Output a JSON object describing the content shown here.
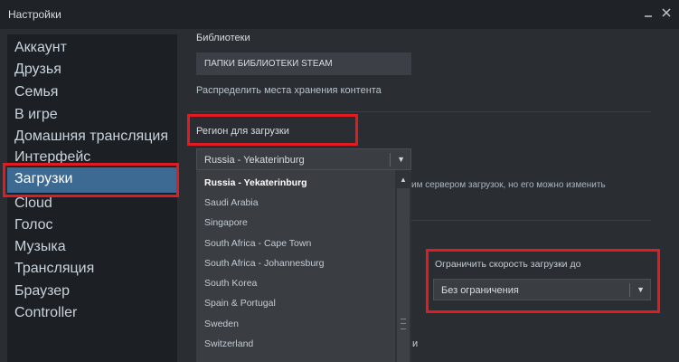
{
  "window": {
    "title": "Настройки"
  },
  "sidebar": {
    "items": [
      {
        "label": "Аккаунт"
      },
      {
        "label": "Друзья"
      },
      {
        "label": "Семья"
      },
      {
        "label": "В игре"
      },
      {
        "label": "Домашняя трансляция"
      },
      {
        "label": "Интерфейс"
      },
      {
        "label": "Загрузки",
        "active": true
      },
      {
        "label": "Cloud"
      },
      {
        "label": "Голос"
      },
      {
        "label": "Музыка"
      },
      {
        "label": "Трансляция"
      },
      {
        "label": "Браузер"
      },
      {
        "label": "Controller"
      }
    ]
  },
  "libraries": {
    "heading": "Библиотеки",
    "button_label": "ПАПКИ БИБЛИОТЕКИ STEAM",
    "description": "Распределить места хранения контента"
  },
  "region": {
    "heading": "Регион для загрузки",
    "selected": "Russia - Yekaterinburg",
    "note_visible": "им сервером загрузок, но его можно изменить",
    "options": [
      "Russia - Yekaterinburg",
      "Saudi Arabia",
      "Singapore",
      "South Africa - Cape Town",
      "South Africa - Johannesburg",
      "South Korea",
      "Spain & Portugal",
      "Sweden",
      "Switzerland"
    ]
  },
  "bandwidth": {
    "label": "Ограничить скорость загрузки до",
    "selected": "Без ограничения"
  },
  "fragments": {
    "right_bottom": "и"
  },
  "colors": {
    "accent": "#3d6a92",
    "highlight_box": "#e01b22"
  }
}
